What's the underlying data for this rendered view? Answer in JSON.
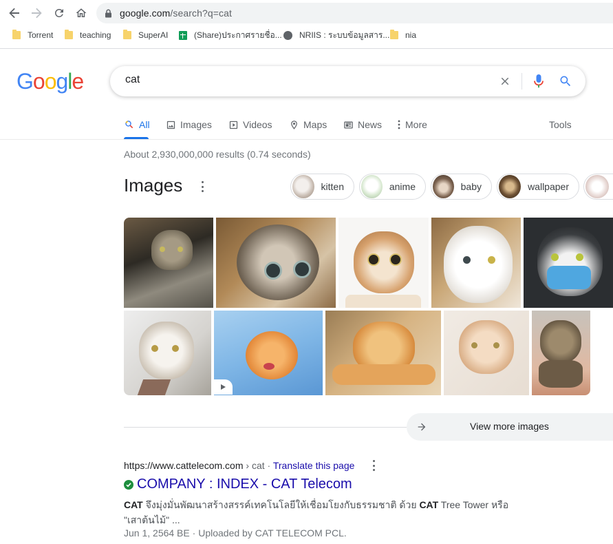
{
  "browser": {
    "url_host": "google.com",
    "url_path": "/search?q=cat",
    "bookmarks": [
      {
        "label": "Torrent",
        "icon": "folder-icon"
      },
      {
        "label": "teaching",
        "icon": "folder-icon"
      },
      {
        "label": "SuperAI",
        "icon": "folder-icon"
      },
      {
        "label": "(Share)ประกาศรายชื่อ...",
        "icon": "sheets-icon"
      },
      {
        "label": "NRIIS : ระบบข้อมูลสาร...",
        "icon": "globe-icon"
      },
      {
        "label": "nia",
        "icon": "folder-icon"
      }
    ]
  },
  "google": {
    "logo": [
      "G",
      "o",
      "o",
      "g",
      "l",
      "e"
    ],
    "logo_colors": [
      "#4285f4",
      "#ea4335",
      "#fbbc05",
      "#4285f4",
      "#34a853",
      "#ea4335"
    ],
    "query": "cat"
  },
  "tabs": [
    {
      "label": "All",
      "icon": "search-icon",
      "active": true
    },
    {
      "label": "Images",
      "icon": "image-icon"
    },
    {
      "label": "Videos",
      "icon": "video-icon"
    },
    {
      "label": "Maps",
      "icon": "map-pin-icon"
    },
    {
      "label": "News",
      "icon": "news-icon"
    },
    {
      "label": "More",
      "icon": "kebab-icon"
    }
  ],
  "tools_label": "Tools",
  "stats": "About 2,930,000,000 results (0.74 seconds)",
  "images": {
    "title": "Images",
    "chips": [
      "kitten",
      "anime",
      "baby",
      "wallpaper",
      ""
    ],
    "view_more": "View more images"
  },
  "result": {
    "url": "https://www.cattelecom.com",
    "breadcrumb": "› cat",
    "sep": "·",
    "translate": "Translate this page",
    "title": "COMPANY : INDEX - CAT Telecom",
    "snippet": {
      "b1": "CAT",
      "t1": " จึงมุ่งมั่นพัฒนาสร้างสรรค์เทคโนโลยีให้เชื่อมโยงกับธรรมชาติ ด้วย ",
      "b2": "CAT",
      "t2": " Tree Tower หรือ \"เสาต้นไม้\" ..."
    },
    "date": "Jun 1, 2564 BE",
    "sep2": "·",
    "uploaded": "Uploaded by CAT TELECOM PCL."
  },
  "colors": {
    "link": "#1a0dab",
    "accent": "#1a73e8",
    "verified": "#1e8e3e"
  }
}
